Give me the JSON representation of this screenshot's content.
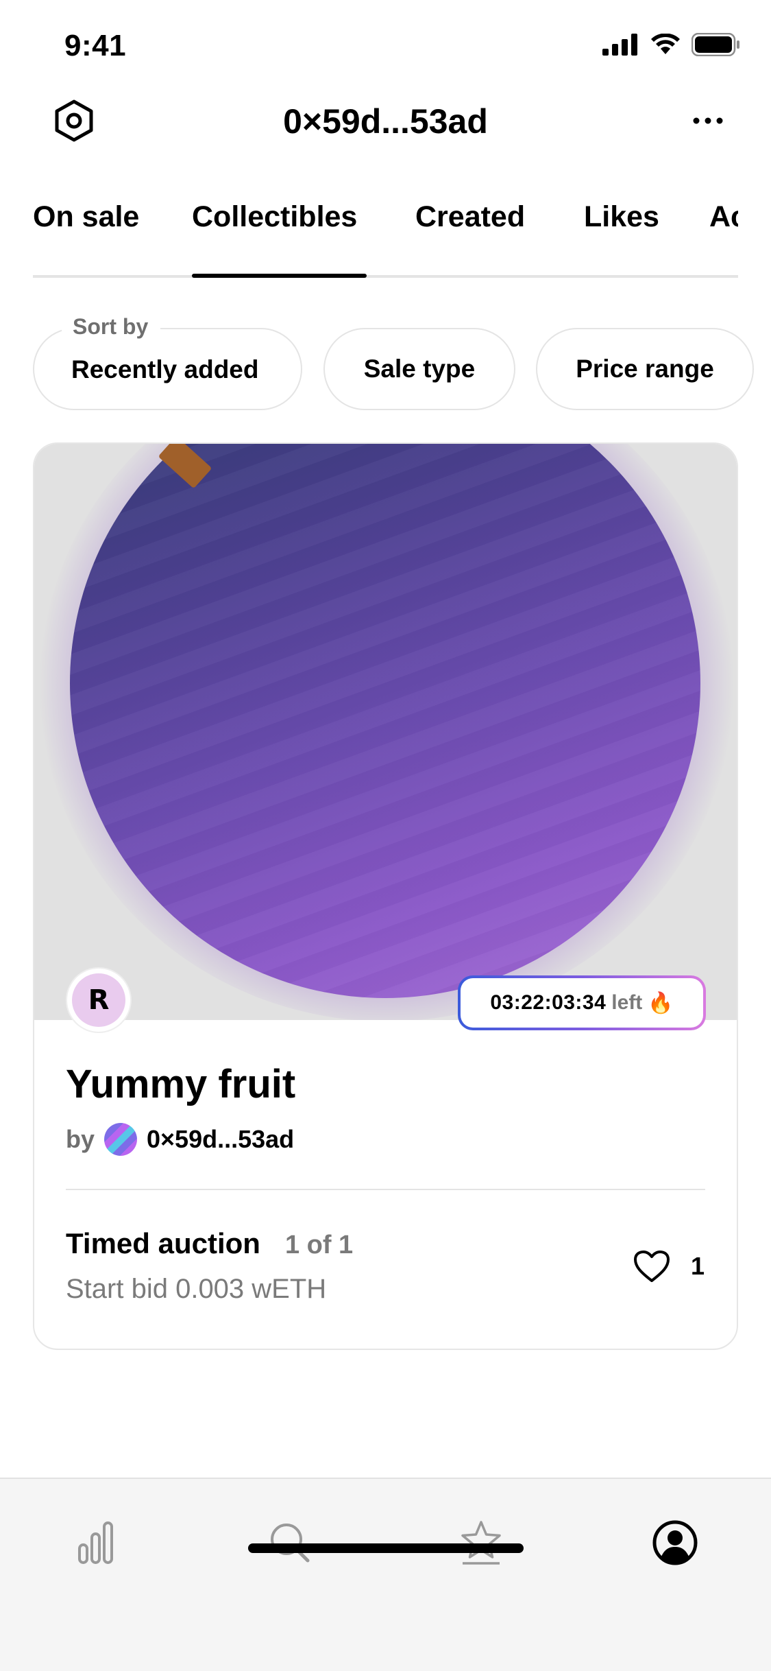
{
  "status_bar": {
    "time": "9:41",
    "icons": [
      "cellular-signal-icon",
      "wifi-icon",
      "battery-icon"
    ]
  },
  "header": {
    "title": "0×59d...53ad",
    "left_icon": "settings-icon",
    "right_icon": "more-icon"
  },
  "tabs": [
    {
      "label": "On sale",
      "active": false
    },
    {
      "label": "Collectibles",
      "active": true
    },
    {
      "label": "Created",
      "active": false
    },
    {
      "label": "Likes",
      "active": false
    },
    {
      "label": "Ac",
      "active": false
    }
  ],
  "filters": {
    "sort_caption": "Sort by",
    "sort_value": "Recently added",
    "sale_type": "Sale type",
    "price_range": "Price range"
  },
  "card": {
    "creator_initial": "R",
    "timer_value": "03:22:03:34",
    "timer_suffix": "left",
    "timer_emoji": "🔥",
    "title": "Yummy fruit",
    "by_label": "by",
    "owner_address": "0×59d...53ad",
    "auction_type": "Timed auction",
    "edition": "1 of 1",
    "start_bid": "Start bid 0.003 wETH",
    "likes": "1"
  },
  "bottom_nav": {
    "items": [
      {
        "icon": "stats-icon",
        "active": false
      },
      {
        "icon": "search-icon",
        "active": false
      },
      {
        "icon": "star-icon",
        "active": false
      },
      {
        "icon": "profile-icon",
        "active": true
      }
    ]
  },
  "colors": {
    "timer_gradient": [
      "#3b5bdb",
      "#7c5ce0",
      "#d97ae0"
    ],
    "muted_text": "#7a7a7a"
  }
}
